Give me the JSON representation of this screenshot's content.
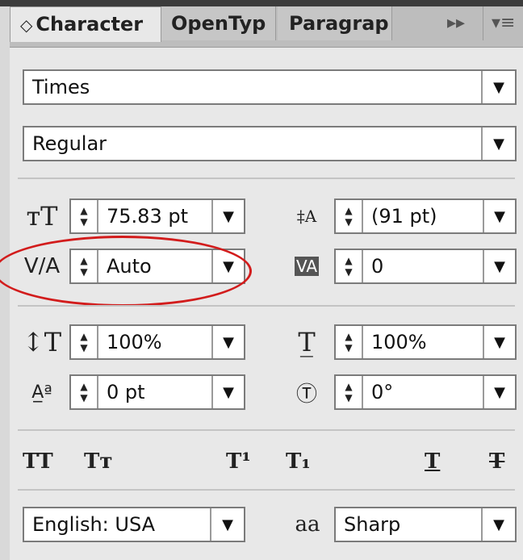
{
  "tabs": [
    {
      "label": "Character",
      "icon": "updown-chevron-icon",
      "active": true
    },
    {
      "label": "OpenTyp",
      "active": false
    },
    {
      "label": "Paragrap",
      "active": false
    }
  ],
  "tab_controls": {
    "expand": "▸▸",
    "menu": "▾≡"
  },
  "font_family": "Times",
  "font_style": "Regular",
  "font_size": "75.83 pt",
  "leading": "(91 pt)",
  "kerning": "Auto",
  "tracking": "0",
  "vertical_scale": "100%",
  "horizontal_scale": "100%",
  "baseline_shift": "0 pt",
  "rotation": "0°",
  "type_buttons": [
    "TT",
    "Tт",
    "T¹",
    "T₁",
    "T",
    "T"
  ],
  "language": "English: USA",
  "aa_icon_label": "aa",
  "anti_aliasing": "Sharp",
  "highlight_color": "#d21c1c"
}
